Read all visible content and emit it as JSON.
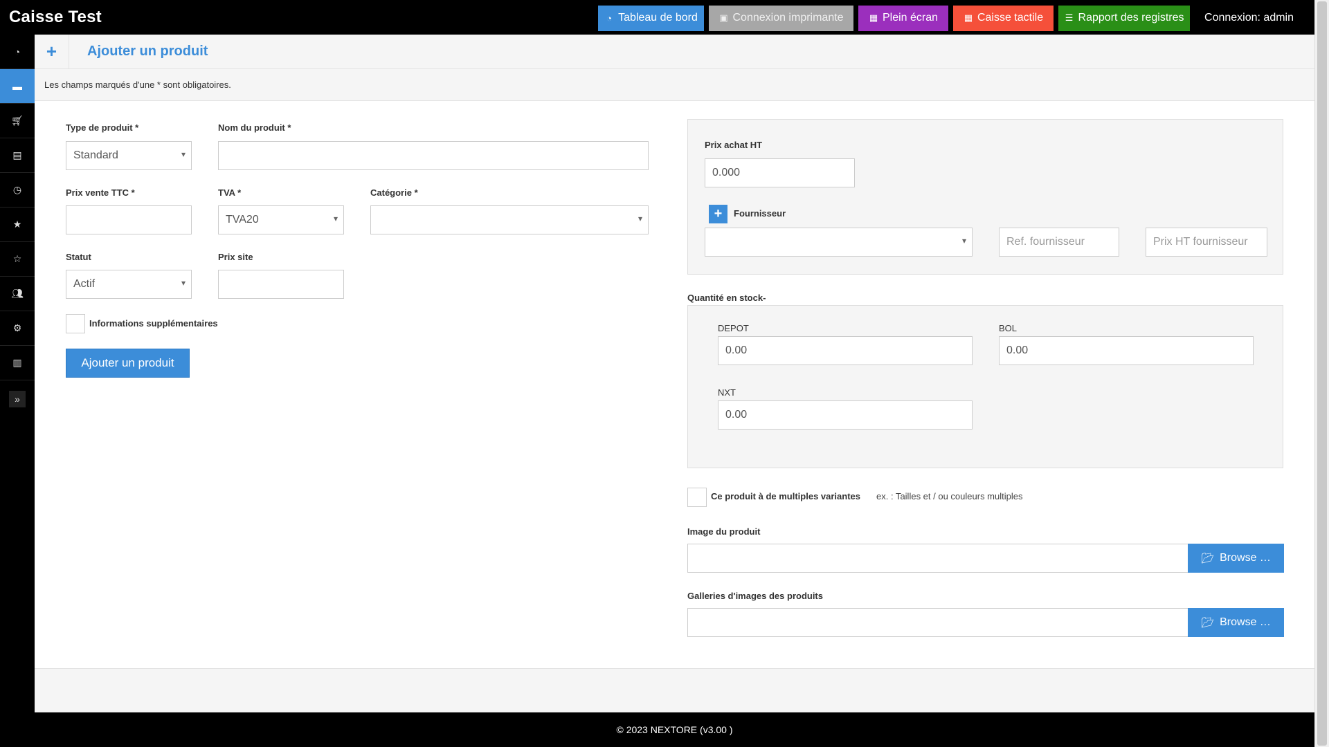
{
  "app": {
    "title": "Caisse Test"
  },
  "topnav": {
    "dashboard": "Tableau de bord",
    "printer": "Connexion imprimante",
    "fullscreen": "Plein écran",
    "touch": "Caisse tactile",
    "report": "Rapport des registres",
    "login": "Connexion: admin"
  },
  "sidebar": {
    "items": [
      {
        "icon": "dashboard-icon"
      },
      {
        "icon": "products-icon",
        "active": true
      },
      {
        "icon": "cart-icon"
      },
      {
        "icon": "document-icon"
      },
      {
        "icon": "clock-icon"
      },
      {
        "icon": "star-icon"
      },
      {
        "icon": "star-outline-icon"
      },
      {
        "icon": "users-icon"
      },
      {
        "icon": "gear-icon"
      },
      {
        "icon": "bar-chart-icon"
      }
    ],
    "toggle_icon": "double-chevron-right-icon"
  },
  "page": {
    "title": "Ajouter un produit",
    "notice": "Les champs marqués d'une * sont obligatoires."
  },
  "form": {
    "type_label": "Type de produit *",
    "type_value": "Standard",
    "name_label": "Nom du produit *",
    "name_value": "",
    "price_label": "Prix vente TTC *",
    "price_value": "",
    "tva_label": "TVA *",
    "tva_value": "TVA20",
    "category_label": "Catégorie *",
    "category_value": "",
    "status_label": "Statut",
    "status_value": "Actif",
    "site_price_label": "Prix site",
    "site_price_value": "",
    "extra_info_label": "Informations supplémentaires",
    "submit_label": "Ajouter un produit"
  },
  "supplier": {
    "purchase_label": "Prix achat HT",
    "purchase_value": "0.000",
    "supplier_label": "Fournisseur",
    "supplier_value": "",
    "ref_placeholder": "Ref. fournisseur",
    "price_placeholder": "Prix HT fournisseur"
  },
  "stock": {
    "label": "Quantité en stock-",
    "warehouses": [
      {
        "name": "DEPOT",
        "value": "0.00"
      },
      {
        "name": "BOL",
        "value": "0.00"
      },
      {
        "name": "NXT",
        "value": "0.00"
      }
    ]
  },
  "variants": {
    "label": "Ce produit à de multiples variantes",
    "hint": "ex. : Tailles et / ou couleurs multiples"
  },
  "images": {
    "image_label": "Image du produit",
    "gallery_label": "Galleries d'images des produits",
    "browse_label": "Browse …",
    "browse_icon": "folder-open-icon"
  },
  "footer": {
    "text": "© 2023 NEXTORE (v3.00 )"
  },
  "colors": {
    "primary": "#3c8dd9",
    "printer": "#a7a7a7",
    "fullscreen": "#9b2fbd",
    "touch": "#f5503a",
    "report": "#2a8f17"
  }
}
